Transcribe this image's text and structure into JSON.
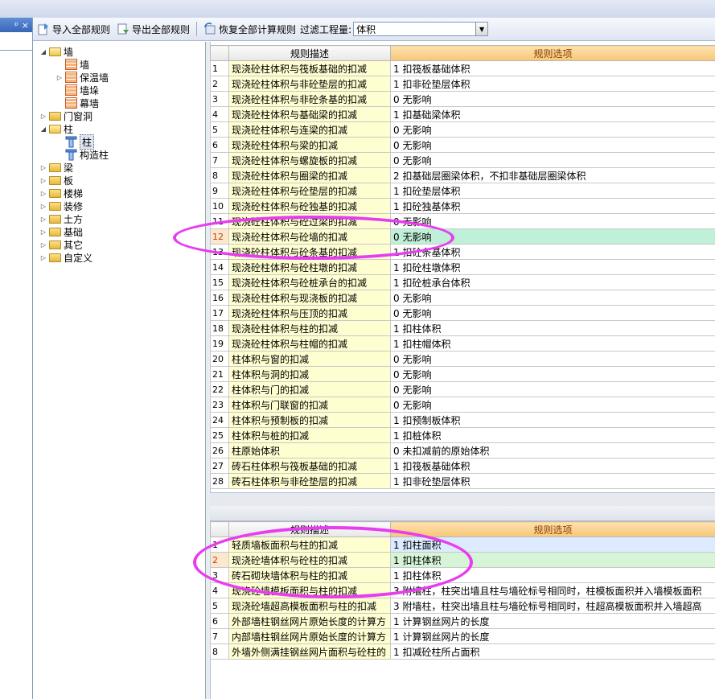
{
  "left_panel": {
    "pin_glyph": "ᵖ",
    "close_glyph": "×"
  },
  "toolbar": {
    "import_label": "导入全部规则",
    "export_label": "导出全部规则",
    "restore_label": "恢复全部计算规则",
    "filter_label": "过滤工程量:",
    "filter_value": "体积"
  },
  "tree": [
    {
      "label": "墙",
      "level": 0,
      "type": "folder",
      "expanded": true
    },
    {
      "label": "墙",
      "level": 1,
      "type": "leaf"
    },
    {
      "label": "保温墙",
      "level": 1,
      "type": "leaf",
      "expander": true
    },
    {
      "label": "墙垛",
      "level": 1,
      "type": "leaf"
    },
    {
      "label": "幕墙",
      "level": 1,
      "type": "leaf"
    },
    {
      "label": "门窗洞",
      "level": 0,
      "type": "folder"
    },
    {
      "label": "柱",
      "level": 0,
      "type": "folder",
      "expanded": true
    },
    {
      "label": "柱",
      "level": 1,
      "type": "column",
      "selected": true
    },
    {
      "label": "构造柱",
      "level": 1,
      "type": "column"
    },
    {
      "label": "梁",
      "level": 0,
      "type": "folder"
    },
    {
      "label": "板",
      "level": 0,
      "type": "folder"
    },
    {
      "label": "楼梯",
      "level": 0,
      "type": "folder"
    },
    {
      "label": "装修",
      "level": 0,
      "type": "folder"
    },
    {
      "label": "土方",
      "level": 0,
      "type": "folder"
    },
    {
      "label": "基础",
      "level": 0,
      "type": "folder"
    },
    {
      "label": "其它",
      "level": 0,
      "type": "folder"
    },
    {
      "label": "自定义",
      "level": 0,
      "type": "folder"
    }
  ],
  "top_grid": {
    "headers": {
      "desc": "规则描述",
      "opt": "规则选项"
    },
    "rows": [
      {
        "n": "1",
        "desc": "现浇砼柱体积与筏板基础的扣减",
        "opt": "1  扣筏板基础体积"
      },
      {
        "n": "2",
        "desc": "现浇砼柱体积与非砼垫层的扣减",
        "opt": "1  扣非砼垫层体积"
      },
      {
        "n": "3",
        "desc": "现浇砼柱体积与非砼条基的扣减",
        "opt": "0    无影响"
      },
      {
        "n": "4",
        "desc": "现浇砼柱体积与基础梁的扣减",
        "opt": "1  扣基础梁体积"
      },
      {
        "n": "5",
        "desc": "现浇砼柱体积与连梁的扣减",
        "opt": "0    无影响"
      },
      {
        "n": "6",
        "desc": "现浇砼柱体积与梁的扣减",
        "opt": "0    无影响"
      },
      {
        "n": "7",
        "desc": "现浇砼柱体积与螺旋板的扣减",
        "opt": "0    无影响"
      },
      {
        "n": "8",
        "desc": "现浇砼柱体积与圈梁的扣减",
        "opt": "2  扣基础层圈梁体积，不扣非基础层圈梁体积"
      },
      {
        "n": "9",
        "desc": "现浇砼柱体积与砼垫层的扣减",
        "opt": "1  扣砼垫层体积"
      },
      {
        "n": "10",
        "desc": "现浇砼柱体积与砼独基的扣减",
        "opt": "1  扣砼独基体积"
      },
      {
        "n": "11",
        "desc": "现浇砼柱体积与砼过梁的扣减",
        "opt": "0    无影响"
      },
      {
        "n": "12",
        "desc": "现浇砼柱体积与砼墙的扣减",
        "opt": "0    无影响"
      },
      {
        "n": "13",
        "desc": "现浇砼柱体积与砼条基的扣减",
        "opt": "1  扣砼条基体积"
      },
      {
        "n": "14",
        "desc": "现浇砼柱体积与砼柱墩的扣减",
        "opt": "1  扣砼柱墩体积"
      },
      {
        "n": "15",
        "desc": "现浇砼柱体积与砼桩承台的扣减",
        "opt": "1  扣砼桩承台体积"
      },
      {
        "n": "16",
        "desc": "现浇砼柱体积与现浇板的扣减",
        "opt": "0    无影响"
      },
      {
        "n": "17",
        "desc": "现浇砼柱体积与压顶的扣减",
        "opt": "0    无影响"
      },
      {
        "n": "18",
        "desc": "现浇砼柱体积与柱的扣减",
        "opt": "1  扣柱体积"
      },
      {
        "n": "19",
        "desc": "现浇砼柱体积与柱帽的扣减",
        "opt": "1  扣柱帽体积"
      },
      {
        "n": "20",
        "desc": "柱体积与窗的扣减",
        "opt": "0    无影响"
      },
      {
        "n": "21",
        "desc": "柱体积与洞的扣减",
        "opt": "0    无影响"
      },
      {
        "n": "22",
        "desc": "柱体积与门的扣减",
        "opt": "0    无影响"
      },
      {
        "n": "23",
        "desc": "柱体积与门联窗的扣减",
        "opt": "0    无影响"
      },
      {
        "n": "24",
        "desc": "柱体积与预制板的扣减",
        "opt": "1  扣预制板体积"
      },
      {
        "n": "25",
        "desc": "柱体积与桩的扣减",
        "opt": "1  扣桩体积"
      },
      {
        "n": "26",
        "desc": "柱原始体积",
        "opt": "0  未扣减前的原始体积"
      },
      {
        "n": "27",
        "desc": "砖石柱体积与筏板基础的扣减",
        "opt": "1  扣筏板基础体积"
      },
      {
        "n": "28",
        "desc": "砖石柱体积与非砼垫层的扣减",
        "opt": "1  扣非砼垫层体积"
      }
    ]
  },
  "bottom_grid": {
    "headers": {
      "desc": "规则描述",
      "opt": "规则选项"
    },
    "rows": [
      {
        "n": "1",
        "desc": "轻质墙板面积与柱的扣减",
        "opt": "1    扣柱面积"
      },
      {
        "n": "2",
        "desc": "现浇砼墙体积与砼柱的扣减",
        "opt": "1    扣柱体积"
      },
      {
        "n": "3",
        "desc": "砖石砌块墙体积与柱的扣减",
        "opt": "1    扣柱体积"
      },
      {
        "n": "4",
        "desc": "现浇砼墙模板面积与柱的扣减",
        "opt": "3    附墙柱，柱突出墙且柱与墙砼标号相同时，柱模板面积并入墙模板面积"
      },
      {
        "n": "5",
        "desc": "现浇砼墙超高模板面积与柱的扣减",
        "opt": "3    附墙柱，柱突出墙且柱与墙砼标号相同时，柱超高模板面积并入墙超高"
      },
      {
        "n": "6",
        "desc": "外部墙柱钢丝网片原始长度的计算方",
        "opt": "1    计算钢丝网片的长度"
      },
      {
        "n": "7",
        "desc": "内部墙柱钢丝网片原始长度的计算方",
        "opt": "1    计算钢丝网片的长度"
      },
      {
        "n": "8",
        "desc": "外墙外侧满挂钢丝网片面积与砼柱的",
        "opt": "1    扣减砼柱所占面积"
      }
    ]
  },
  "colors": {
    "annotation": "#e83cf0",
    "desc_bg": "#fffed0",
    "selected_opt": "#bff0d8"
  }
}
